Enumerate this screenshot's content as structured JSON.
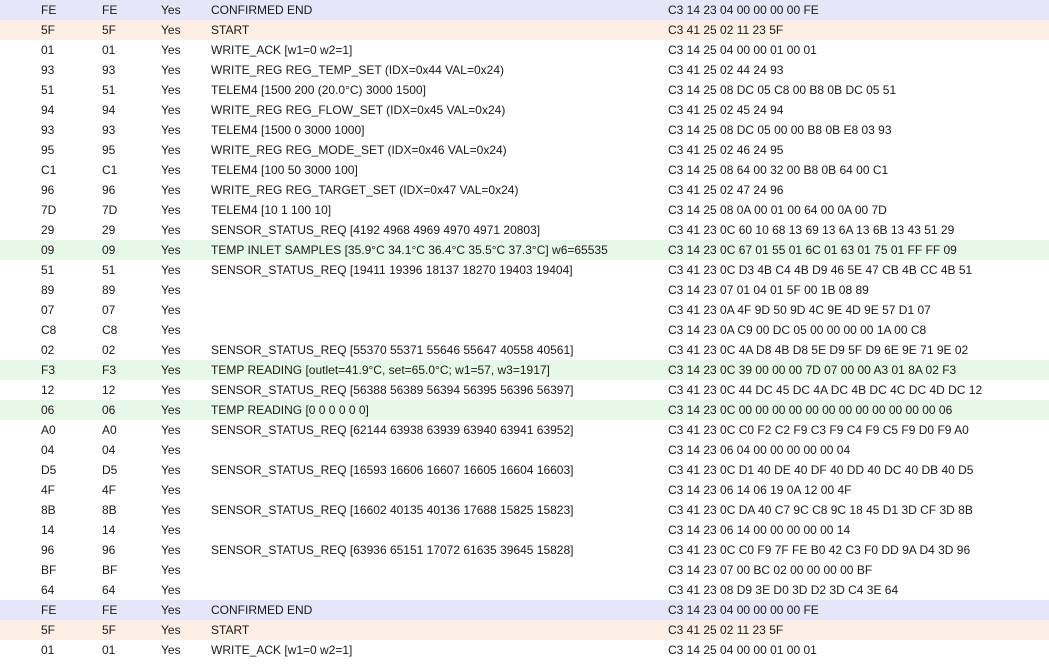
{
  "rows": [
    {
      "kind": "end",
      "c": [
        "FE",
        "FE",
        "Yes",
        "CONFIRMED END",
        "C3 14 23 04 00 00 00 00 FE"
      ]
    },
    {
      "kind": "start",
      "c": [
        "5F",
        "5F",
        "Yes",
        "START",
        "C3 41 25 02 11 23 5F"
      ]
    },
    {
      "kind": "",
      "c": [
        "01",
        "01",
        "Yes",
        "WRITE_ACK [w1=0 w2=1]",
        "C3 14 25 04 00 00 01 00 01"
      ]
    },
    {
      "kind": "",
      "c": [
        "93",
        "93",
        "Yes",
        "WRITE_REG REG_TEMP_SET (IDX=0x44 VAL=0x24)",
        "C3 41 25 02 44 24 93"
      ]
    },
    {
      "kind": "",
      "c": [
        "51",
        "51",
        "Yes",
        "TELEM4 [1500 200 (20.0°C) 3000 1500]",
        "C3 14 25 08 DC 05 C8 00 B8 0B DC 05 51"
      ]
    },
    {
      "kind": "",
      "c": [
        "94",
        "94",
        "Yes",
        "WRITE_REG REG_FLOW_SET (IDX=0x45 VAL=0x24)",
        "C3 41 25 02 45 24 94"
      ]
    },
    {
      "kind": "",
      "c": [
        "93",
        "93",
        "Yes",
        "TELEM4 [1500 0 3000 1000]",
        "C3 14 25 08 DC 05 00 00 B8 0B E8 03 93"
      ]
    },
    {
      "kind": "",
      "c": [
        "95",
        "95",
        "Yes",
        "WRITE_REG REG_MODE_SET (IDX=0x46 VAL=0x24)",
        "C3 41 25 02 46 24 95"
      ]
    },
    {
      "kind": "",
      "c": [
        "C1",
        "C1",
        "Yes",
        "TELEM4 [100 50 3000 100]",
        "C3 14 25 08 64 00 32 00 B8 0B 64 00 C1"
      ]
    },
    {
      "kind": "",
      "c": [
        "96",
        "96",
        "Yes",
        "WRITE_REG REG_TARGET_SET (IDX=0x47 VAL=0x24)",
        "C3 41 25 02 47 24 96"
      ]
    },
    {
      "kind": "",
      "c": [
        "7D",
        "7D",
        "Yes",
        "TELEM4 [10 1 100 10]",
        "C3 14 25 08 0A 00 01 00 64 00 0A 00 7D"
      ]
    },
    {
      "kind": "",
      "c": [
        "29",
        "29",
        "Yes",
        "SENSOR_STATUS_REQ [4192 4968 4969 4970 4971 20803]",
        "C3 41 23 0C 60 10 68 13 69 13 6A 13 6B 13 43 51 29"
      ]
    },
    {
      "kind": "temp",
      "c": [
        "09",
        "09",
        "Yes",
        "TEMP INLET SAMPLES [35.9°C 34.1°C 36.4°C 35.5°C 37.3°C] w6=65535",
        "C3 14 23 0C 67 01 55 01 6C 01 63 01 75 01 FF FF 09"
      ]
    },
    {
      "kind": "",
      "c": [
        "51",
        "51",
        "Yes",
        "SENSOR_STATUS_REQ [19411 19396 18137 18270 19403 19404]",
        "C3 41 23 0C D3 4B C4 4B D9 46 5E 47 CB 4B CC 4B 51"
      ]
    },
    {
      "kind": "",
      "c": [
        "89",
        "89",
        "Yes",
        "",
        "C3 14 23 07 01 04 01 5F 00 1B 08 89"
      ]
    },
    {
      "kind": "",
      "c": [
        "07",
        "07",
        "Yes",
        "",
        "C3 41 23 0A 4F 9D 50 9D 4C 9E 4D 9E 57 D1 07"
      ]
    },
    {
      "kind": "",
      "c": [
        "C8",
        "C8",
        "Yes",
        "",
        "C3 14 23 0A C9 00 DC 05 00 00 00 00 1A 00 C8"
      ]
    },
    {
      "kind": "",
      "c": [
        "02",
        "02",
        "Yes",
        "SENSOR_STATUS_REQ [55370 55371 55646 55647 40558 40561]",
        "C3 41 23 0C 4A D8 4B D8 5E D9 5F D9 6E 9E 71 9E 02"
      ]
    },
    {
      "kind": "temp",
      "c": [
        "F3",
        "F3",
        "Yes",
        "TEMP READING [outlet=41.9°C, set=65.0°C; w1=57, w3=1917]",
        "C3 14 23 0C 39 00 00 00 7D 07 00 00 A3 01 8A 02 F3"
      ]
    },
    {
      "kind": "",
      "c": [
        "12",
        "12",
        "Yes",
        "SENSOR_STATUS_REQ [56388 56389 56394 56395 56396 56397]",
        "C3 41 23 0C 44 DC 45 DC 4A DC 4B DC 4C DC 4D DC 12"
      ]
    },
    {
      "kind": "temp",
      "c": [
        "06",
        "06",
        "Yes",
        "TEMP READING [0 0 0 0 0 0]",
        "C3 14 23 0C 00 00 00 00 00 00 00 00 00 00 00 00 06"
      ]
    },
    {
      "kind": "",
      "c": [
        "A0",
        "A0",
        "Yes",
        "SENSOR_STATUS_REQ [62144 63938 63939 63940 63941 63952]",
        "C3 41 23 0C C0 F2 C2 F9 C3 F9 C4 F9 C5 F9 D0 F9 A0"
      ]
    },
    {
      "kind": "",
      "c": [
        "04",
        "04",
        "Yes",
        "",
        "C3 14 23 06 04 00 00 00 00 00 04"
      ]
    },
    {
      "kind": "",
      "c": [
        "D5",
        "D5",
        "Yes",
        "SENSOR_STATUS_REQ [16593 16606 16607 16605 16604 16603]",
        "C3 41 23 0C D1 40 DE 40 DF 40 DD 40 DC 40 DB 40 D5"
      ]
    },
    {
      "kind": "",
      "c": [
        "4F",
        "4F",
        "Yes",
        "",
        "C3 14 23 06 14 06 19 0A 12 00 4F"
      ]
    },
    {
      "kind": "",
      "c": [
        "8B",
        "8B",
        "Yes",
        "SENSOR_STATUS_REQ [16602 40135 40136 17688 15825 15823]",
        "C3 41 23 0C DA 40 C7 9C C8 9C 18 45 D1 3D CF 3D 8B"
      ]
    },
    {
      "kind": "",
      "c": [
        "14",
        "14",
        "Yes",
        "",
        "C3 14 23 06 14 00 00 00 00 00 14"
      ]
    },
    {
      "kind": "",
      "c": [
        "96",
        "96",
        "Yes",
        "SENSOR_STATUS_REQ [63936 65151 17072 61635 39645 15828]",
        "C3 41 23 0C C0 F9 7F FE B0 42 C3 F0 DD 9A D4 3D 96"
      ]
    },
    {
      "kind": "",
      "c": [
        "BF",
        "BF",
        "Yes",
        "",
        "C3 14 23 07 00 BC 02 00 00 00 00 BF"
      ]
    },
    {
      "kind": "",
      "c": [
        "64",
        "64",
        "Yes",
        "",
        "C3 41 23 08 D9 3E D0 3D D2 3D C4 3E 64"
      ]
    },
    {
      "kind": "end",
      "c": [
        "FE",
        "FE",
        "Yes",
        "CONFIRMED END",
        "C3 14 23 04 00 00 00 00 FE"
      ]
    },
    {
      "kind": "start",
      "c": [
        "5F",
        "5F",
        "Yes",
        "START",
        "C3 41 25 02 11 23 5F"
      ]
    },
    {
      "kind": "",
      "c": [
        "01",
        "01",
        "Yes",
        "WRITE_ACK [w1=0 w2=1]",
        "C3 14 25 04 00 00 01 00 01"
      ]
    }
  ],
  "colors": {
    "end_row": "#e6e6f8",
    "start_row": "#fdeee6",
    "temp_row": "#e8f8e8"
  }
}
